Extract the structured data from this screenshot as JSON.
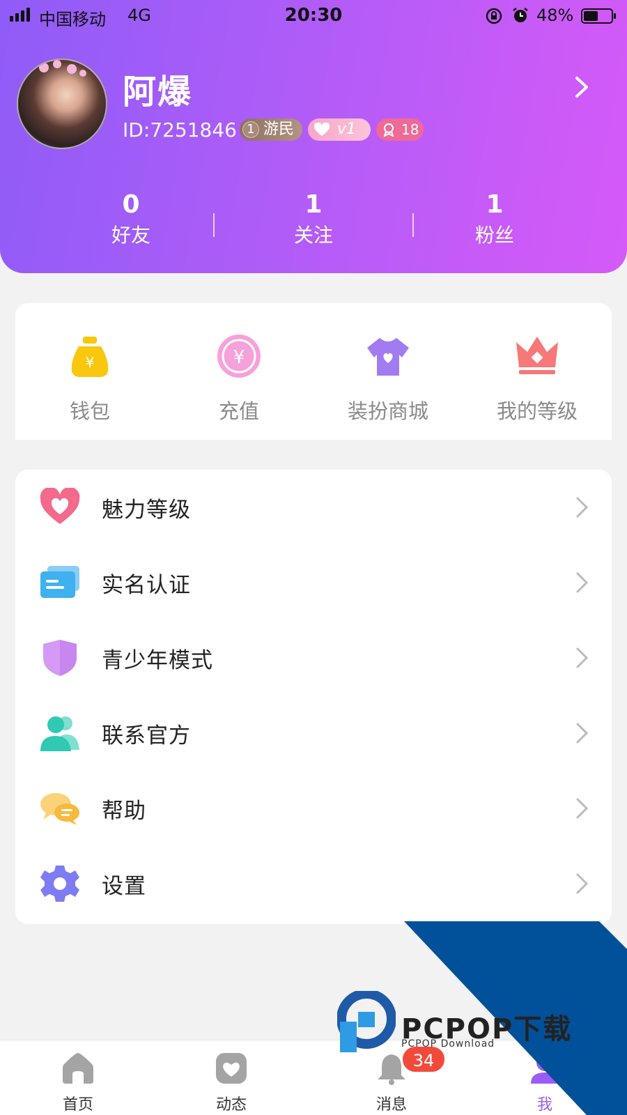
{
  "status_bar": {
    "carrier": "中国移动",
    "network": "4G",
    "time": "20:30",
    "battery": "48%"
  },
  "profile": {
    "name": "阿爆",
    "id": "ID:7251846",
    "rank_badge": {
      "number": "1",
      "label": "游民"
    },
    "vip_badge": "v1",
    "level_badge": "18"
  },
  "stats": [
    {
      "value": "0",
      "label": "好友"
    },
    {
      "value": "1",
      "label": "关注"
    },
    {
      "value": "1",
      "label": "粉丝"
    }
  ],
  "quick_menu": [
    {
      "label": "钱包",
      "icon": "money-bag-icon"
    },
    {
      "label": "充值",
      "icon": "yuan-coin-icon"
    },
    {
      "label": "装扮商城",
      "icon": "tshirt-icon"
    },
    {
      "label": "我的等级",
      "icon": "crown-icon"
    }
  ],
  "menu_list": [
    {
      "label": "魅力等级",
      "icon": "heart-icon"
    },
    {
      "label": "实名认证",
      "icon": "id-card-icon"
    },
    {
      "label": "青少年模式",
      "icon": "shield-icon"
    },
    {
      "label": "联系官方",
      "icon": "people-icon"
    },
    {
      "label": "帮助",
      "icon": "chat-bubbles-icon"
    },
    {
      "label": "设置",
      "icon": "gear-icon"
    }
  ],
  "watermark": {
    "brand": "PCPOP下载",
    "sub": "PCPOP Download"
  },
  "tabbar": {
    "items": [
      {
        "label": "首页",
        "icon": "home-icon"
      },
      {
        "label": "动态",
        "icon": "heart-box-icon"
      },
      {
        "label": "消息",
        "icon": "bell-icon"
      },
      {
        "label": "我",
        "icon": "profile-icon"
      }
    ],
    "message_badge": "34",
    "active_index": 3
  },
  "colors": {
    "header_gradient_start": "#8f5cf7",
    "header_gradient_end": "#d65af7",
    "accent": "#9b5cf6",
    "badge_red": "#f24a3a"
  }
}
